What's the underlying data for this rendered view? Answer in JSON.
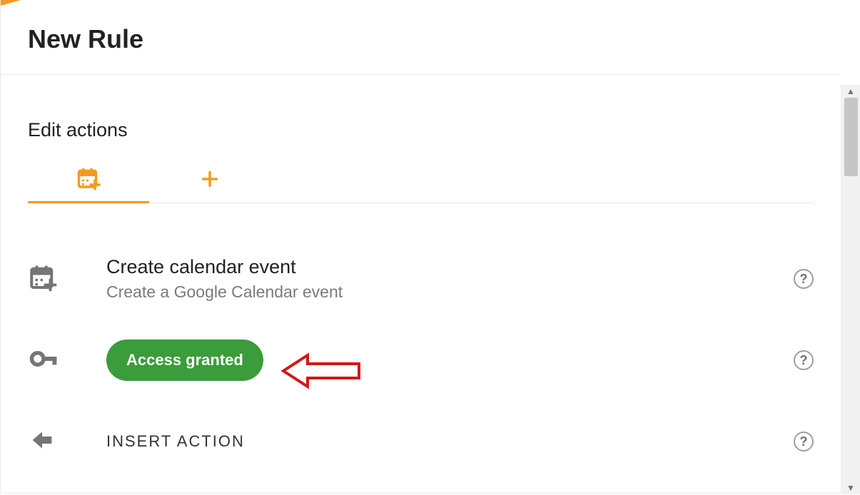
{
  "header": {
    "title": "New Rule"
  },
  "section": {
    "title": "Edit actions"
  },
  "tabs": [
    {
      "id": "calendar",
      "icon": "calendar-add",
      "active": true
    },
    {
      "id": "add",
      "icon": "plus",
      "active": false
    }
  ],
  "actions": {
    "event": {
      "title": "Create calendar event",
      "subtitle": "Create a Google Calendar event"
    },
    "access": {
      "chip_label": "Access granted"
    },
    "insert": {
      "label": "INSERT ACTION"
    }
  },
  "colors": {
    "accent": "#f39a1f",
    "chip_green": "#3a9c3a",
    "annotation_red": "#d11919"
  }
}
